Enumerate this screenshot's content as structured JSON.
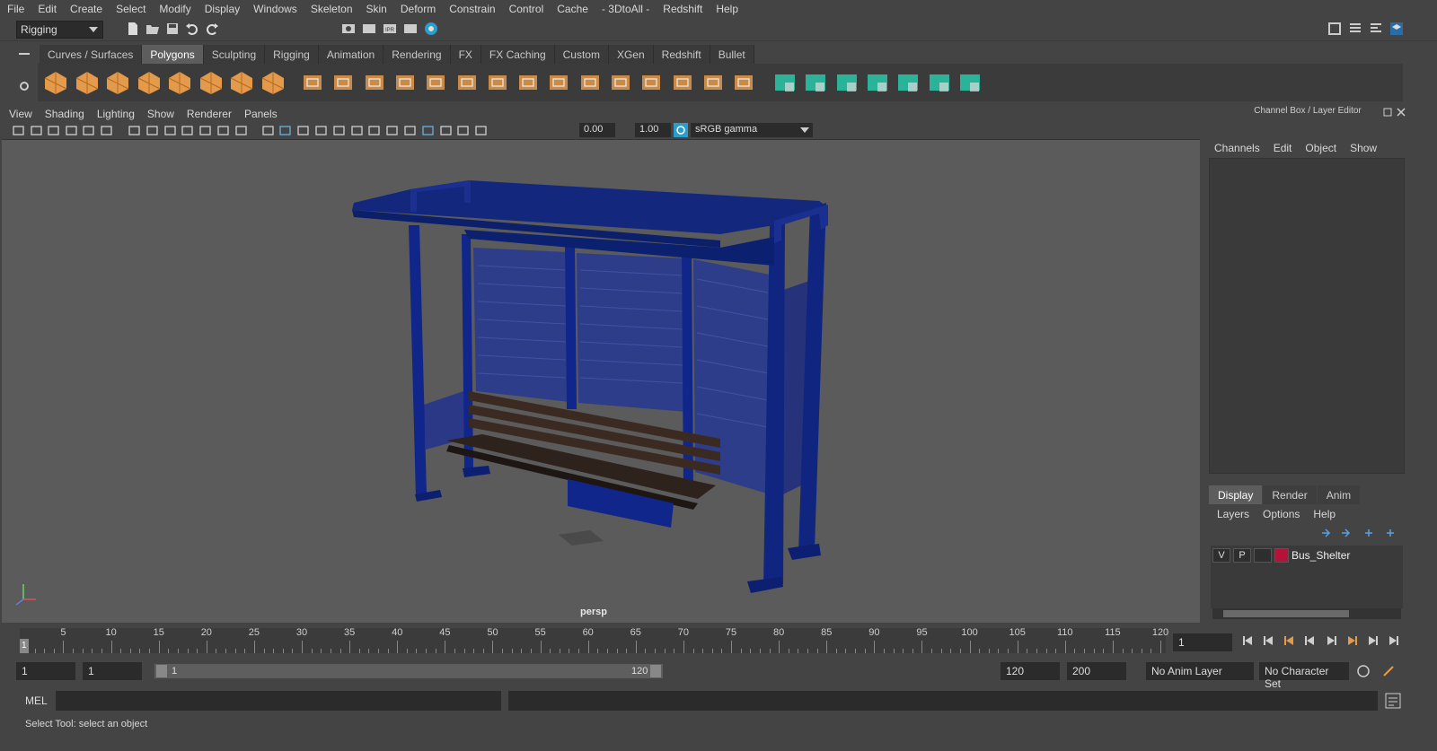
{
  "menubar": {
    "items": [
      "File",
      "Edit",
      "Create",
      "Select",
      "Modify",
      "Display",
      "Windows",
      "Skeleton",
      "Skin",
      "Deform",
      "Constrain",
      "Control",
      "Cache",
      "- 3DtoAll -",
      "Redshift",
      "Help"
    ]
  },
  "status": {
    "menu_set": "Rigging"
  },
  "shelf": {
    "tabs": [
      "Curves / Surfaces",
      "Polygons",
      "Sculpting",
      "Rigging",
      "Animation",
      "Rendering",
      "FX",
      "FX Caching",
      "Custom",
      "XGen",
      "Redshift",
      "Bullet"
    ],
    "active_tab": "Polygons"
  },
  "viewport": {
    "menu": [
      "View",
      "Shading",
      "Lighting",
      "Show",
      "Renderer",
      "Panels"
    ],
    "exposure": "0.00",
    "gamma": "1.00",
    "color_space": "sRGB gamma",
    "camera_label": "persp",
    "axis_x": "x",
    "axis_y": "y"
  },
  "channel_box": {
    "title": "Channel Box / Layer Editor",
    "menu": [
      "Channels",
      "Edit",
      "Object",
      "Show"
    ]
  },
  "layer_editor": {
    "tabs": [
      "Display",
      "Render",
      "Anim"
    ],
    "active_tab": "Display",
    "menu": [
      "Layers",
      "Options",
      "Help"
    ],
    "layer": {
      "v": "V",
      "p": "P",
      "name": "Bus_Shelter",
      "color": "#b5123a"
    }
  },
  "timeline": {
    "ticks": [
      "5",
      "10",
      "15",
      "20",
      "25",
      "30",
      "35",
      "40",
      "45",
      "50",
      "55",
      "60",
      "65",
      "70",
      "75",
      "80",
      "85",
      "90",
      "95",
      "100",
      "105",
      "110",
      "115",
      "120"
    ],
    "current_frame_marker": "1",
    "current_frame": "1"
  },
  "range": {
    "start": "1",
    "playback_start": "1",
    "slider_start": "1",
    "slider_end": "120",
    "playback_end": "120",
    "end": "200",
    "anim_layer": "No Anim Layer",
    "char_set": "No Character Set"
  },
  "command_line": {
    "label": "MEL"
  },
  "help_line": {
    "text": "Select Tool: select an object"
  },
  "colors": {
    "accent_teal": "#2a9d8f",
    "shelf_orange": "#e39a4a",
    "shelf_green": "#2bb39a",
    "model_blue": "#0d2a7a"
  }
}
